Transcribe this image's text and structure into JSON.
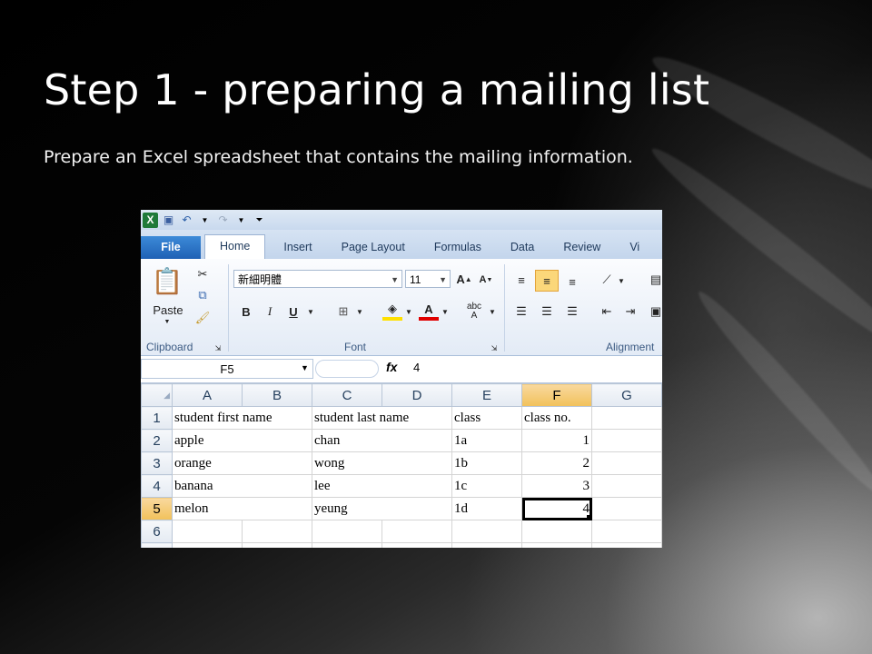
{
  "slide": {
    "title": "Step 1 - preparing a mailing list",
    "subtitle": "Prepare an Excel spreadsheet that contains the mailing information."
  },
  "excel": {
    "tabs": [
      "File",
      "Home",
      "Insert",
      "Page Layout",
      "Formulas",
      "Data",
      "Review",
      "Vi"
    ],
    "active_tab": "Home",
    "ribbon": {
      "paste_label": "Paste",
      "font_name": "新細明體",
      "font_size": "11",
      "clipboard_label": "Clipboard",
      "font_label": "Font",
      "alignment_label": "Alignment"
    },
    "formula_bar": {
      "name_box": "F5",
      "fx": "fx",
      "value": "4"
    },
    "columns": [
      "A",
      "B",
      "C",
      "D",
      "E",
      "F",
      "G"
    ],
    "selected_column": "F",
    "rows": [
      {
        "n": "1",
        "a": "student first name",
        "c": "student last name",
        "e": "class",
        "f": "class no."
      },
      {
        "n": "2",
        "a": "apple",
        "c": "chan",
        "e": "1a",
        "f": "1"
      },
      {
        "n": "3",
        "a": "orange",
        "c": "wong",
        "e": "1b",
        "f": "2"
      },
      {
        "n": "4",
        "a": "banana",
        "c": "lee",
        "e": "1c",
        "f": "3"
      },
      {
        "n": "5",
        "a": "melon",
        "c": "yeung",
        "e": "1d",
        "f": "4"
      },
      {
        "n": "6",
        "a": "",
        "c": "",
        "e": "",
        "f": ""
      }
    ],
    "selected_row": "5",
    "colors": {
      "selected_header": "#f1c15a",
      "file_tab": "#1f61b5",
      "excel_logo": "#1f7a3a"
    }
  }
}
